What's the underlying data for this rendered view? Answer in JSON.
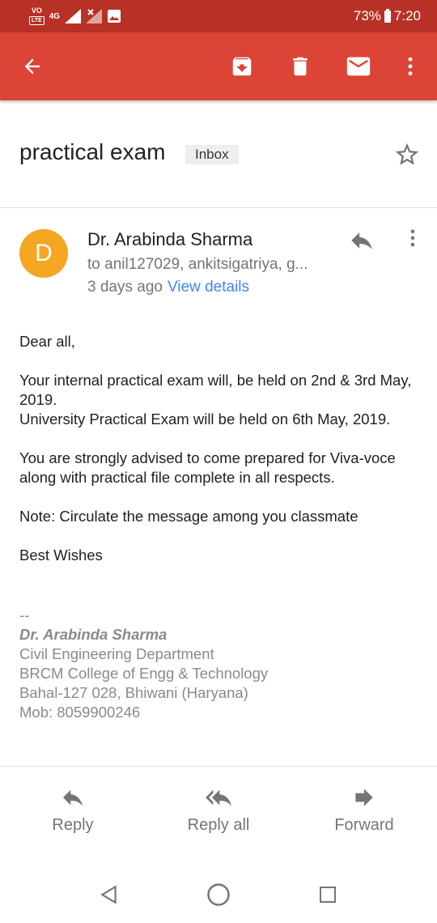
{
  "status_bar": {
    "volte_label": "VO",
    "lte_label": "LTE",
    "network_label": "4G",
    "battery_percent": "73%",
    "time": "7:20"
  },
  "toolbar": {
    "icons": [
      "back-arrow-icon",
      "archive-icon",
      "delete-icon",
      "mark-unread-icon",
      "more-vert-icon"
    ],
    "color": "#db4437"
  },
  "email": {
    "subject": "practical exam",
    "label": "Inbox",
    "sender": {
      "initial": "D",
      "name": "Dr. Arabinda Sharma",
      "avatar_color": "#f5a623"
    },
    "recipients": "to anil127029, ankitsigatriya, g...",
    "time_ago": "3 days ago",
    "view_details": "View details",
    "body": {
      "greeting": "Dear all,",
      "para1_line1": "Your internal practical exam will, be held on 2nd & 3rd May, 2019.",
      "para1_line2": "University Practical Exam will be held on 6th May, 2019.",
      "para2": "You are strongly advised to come prepared for Viva-voce along with practical file complete in all respects.",
      "note": "Note: Circulate the message among you classmate",
      "closing": "Best Wishes"
    },
    "signature": {
      "separator": "--",
      "name": "Dr. Arabinda Sharma",
      "department": "Civil Engineering Department",
      "college": "BRCM College of Engg & Technology",
      "address": "Bahal-127 028, Bhiwani (Haryana)",
      "mobile": "Mob: 8059900246"
    }
  },
  "actions": {
    "reply": "Reply",
    "reply_all": "Reply all",
    "forward": "Forward"
  }
}
